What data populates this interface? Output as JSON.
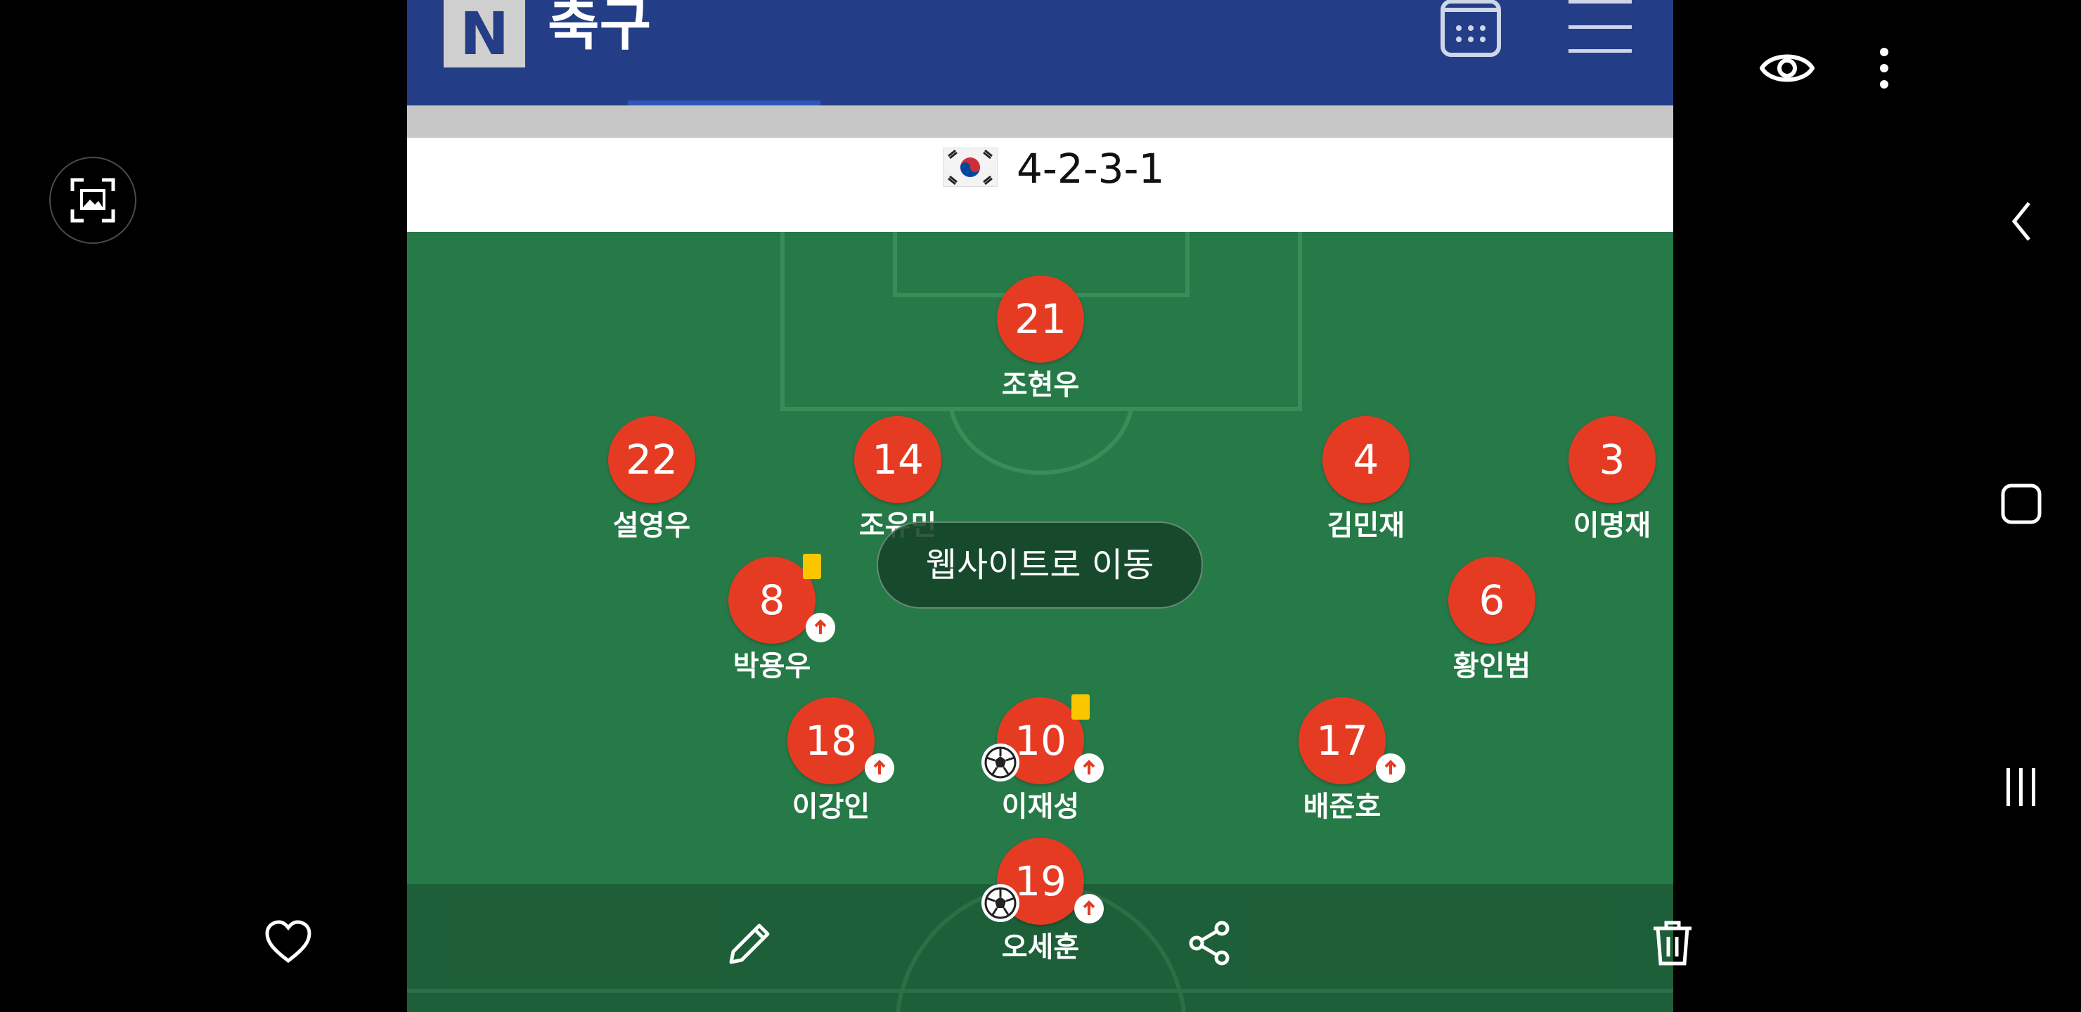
{
  "app": {
    "title": "축구",
    "logo_letter": "N"
  },
  "formation": {
    "label": "4-2-3-1",
    "flag": "south-korea-flag"
  },
  "players": [
    {
      "number": "21",
      "name": "조현우",
      "yellow_card": false,
      "subbed": false,
      "goal": false
    },
    {
      "number": "22",
      "name": "설영우",
      "yellow_card": false,
      "subbed": false,
      "goal": false
    },
    {
      "number": "14",
      "name": "조유민",
      "yellow_card": false,
      "subbed": false,
      "goal": false
    },
    {
      "number": "4",
      "name": "김민재",
      "yellow_card": false,
      "subbed": false,
      "goal": false
    },
    {
      "number": "3",
      "name": "이명재",
      "yellow_card": false,
      "subbed": false,
      "goal": false
    },
    {
      "number": "8",
      "name": "박용우",
      "yellow_card": true,
      "subbed": true,
      "goal": false
    },
    {
      "number": "6",
      "name": "황인범",
      "yellow_card": false,
      "subbed": false,
      "goal": false
    },
    {
      "number": "18",
      "name": "이강인",
      "yellow_card": false,
      "subbed": true,
      "goal": false
    },
    {
      "number": "10",
      "name": "이재성",
      "yellow_card": true,
      "subbed": true,
      "goal": true
    },
    {
      "number": "17",
      "name": "배준호",
      "yellow_card": false,
      "subbed": true,
      "goal": false
    },
    {
      "number": "19",
      "name": "오세훈",
      "yellow_card": false,
      "subbed": true,
      "goal": true
    }
  ],
  "toast": {
    "label": "웹사이트로 이동"
  },
  "icons": {
    "scan": "image-scan-icon",
    "eye": "eye-icon",
    "more": "more-vertical-icon",
    "back": "chevron-left-icon",
    "home": "home-square-icon",
    "recents": "recents-icon",
    "calendar": "calendar-icon",
    "menu": "hamburger-menu-icon",
    "heart": "heart-icon",
    "edit": "pencil-icon",
    "share": "share-icon",
    "delete": "trash-icon"
  },
  "colors": {
    "header": "#233e86",
    "pitch": "#267a48",
    "player": "#e63b23",
    "yellow_card": "#f9c600"
  }
}
